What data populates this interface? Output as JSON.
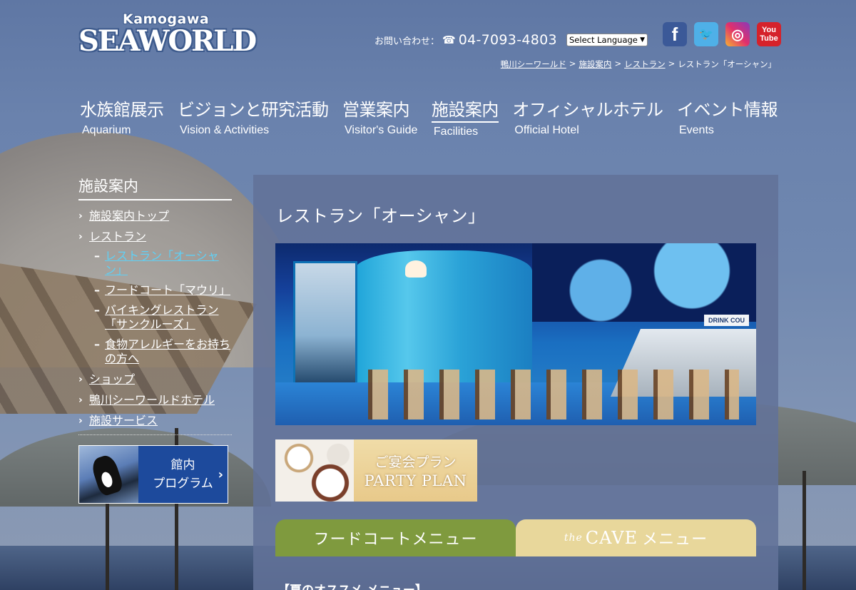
{
  "logo": {
    "top": "Kamogawa",
    "main": "SEAWORLD"
  },
  "header": {
    "contact_label": "お問い合わせ：",
    "tel": "04-7093-4803",
    "language_select": "Select Language",
    "social": [
      {
        "name": "facebook-icon",
        "glyph": "f"
      },
      {
        "name": "twitter-icon",
        "glyph": "🐦"
      },
      {
        "name": "instagram-icon",
        "glyph": "◎"
      },
      {
        "name": "youtube-icon",
        "glyph_top": "You",
        "glyph_bottom": "Tube"
      }
    ]
  },
  "breadcrumb": [
    "鴨川シーワールド",
    ">",
    "施設案内",
    ">",
    "レストラン",
    ">",
    "レストラン「オーシャン」"
  ],
  "nav": [
    {
      "jp": "水族館展示",
      "en": "Aquarium"
    },
    {
      "jp": "ビジョンと研究活動",
      "en": "Vision & Activities"
    },
    {
      "jp": "営業案内",
      "en": "Visitor's Guide"
    },
    {
      "jp": "施設案内",
      "en": "Facilities"
    },
    {
      "jp": "オフィシャルホテル",
      "en": "Official Hotel"
    },
    {
      "jp": "イベント情報",
      "en": "Events"
    }
  ],
  "sidebar": {
    "title": "施設案内",
    "items": [
      "施設案内トップ",
      "レストラン",
      "ショップ",
      "鴨川シーワールドホテル",
      "施設サービス"
    ],
    "sub_items": [
      "レストラン「オーシャン」",
      "フードコート「マウリ」",
      "バイキングレストラン「サンクルーズ」",
      "食物アレルギーをお持ちの方へ"
    ],
    "program": {
      "line1": "館内",
      "line2": "プログラム"
    }
  },
  "main": {
    "title": "レストラン「オーシャン」",
    "hero_sign": "DRINK COU",
    "party": {
      "jp": "ご宴会プラン",
      "en": "PARTY PLAN"
    },
    "tabs": {
      "food": "フードコートメニュー",
      "cave_the": "the",
      "cave_main": "CAVE",
      "cave_suffix": "メニュー"
    },
    "summer_heading": "【夏のオススメ メニュー】"
  },
  "colors": {
    "accent_current": "#5fd0f5",
    "tab_food": "#7f9a3e",
    "tab_cave": "#e8d79b",
    "program_blue": "#1d4a9c"
  }
}
